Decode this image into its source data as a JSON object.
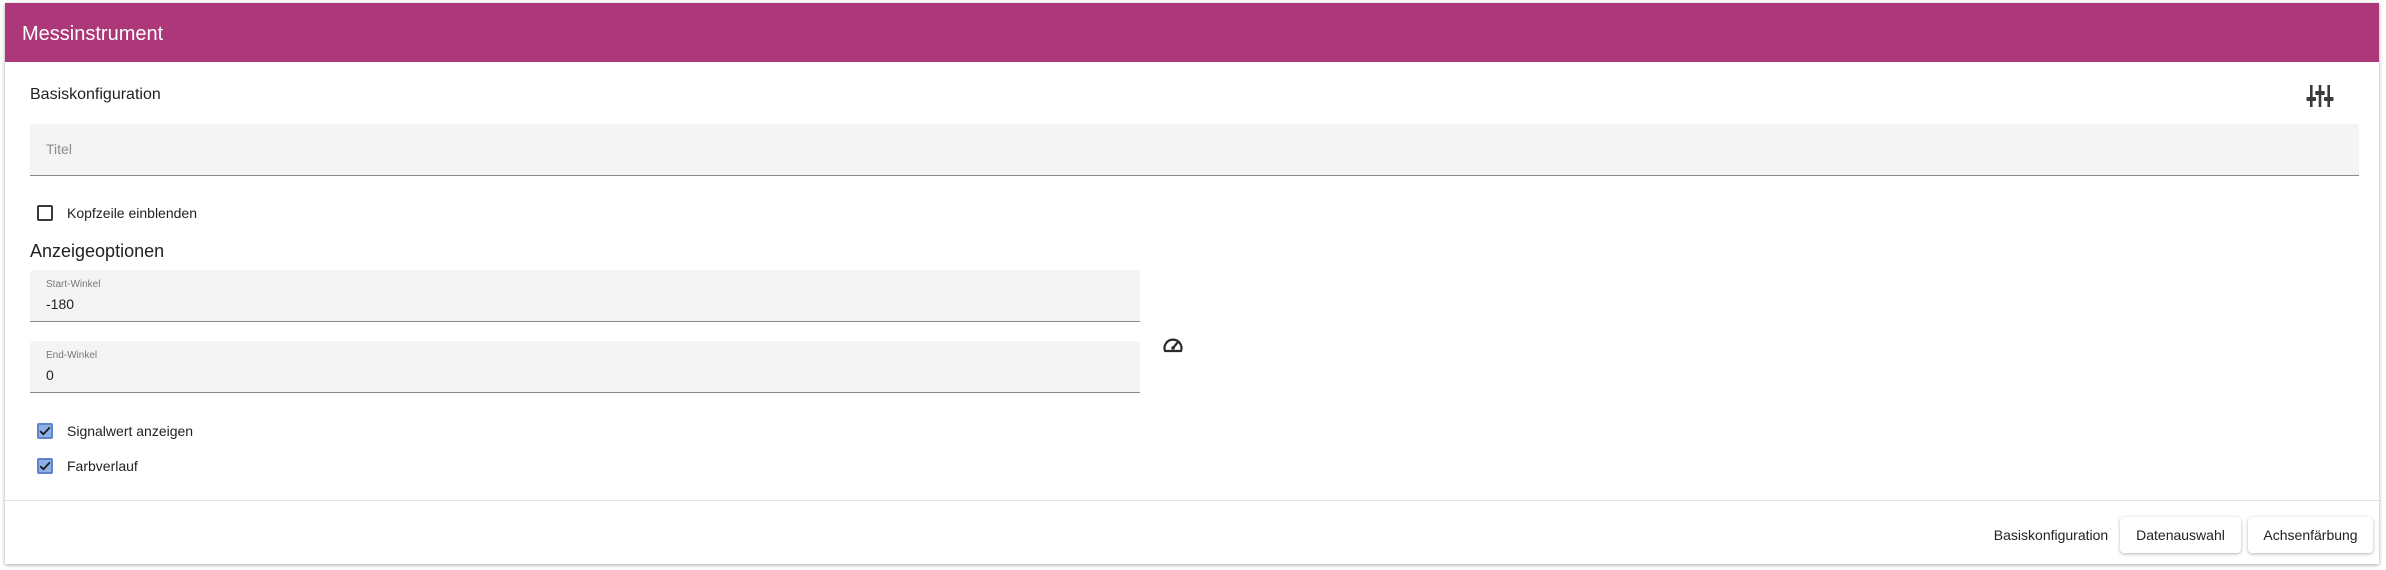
{
  "dialog": {
    "title": "Messinstrument"
  },
  "basis": {
    "section_title": "Basiskonfiguration",
    "tune_icon": "tune-sliders-icon",
    "title_field": {
      "placeholder": "Titel",
      "value": ""
    },
    "show_header": {
      "label": "Kopfzeile einblenden",
      "checked": false
    }
  },
  "display_options": {
    "heading": "Anzeigeoptionen",
    "start_angle": {
      "label": "Start-Winkel",
      "value": "-180"
    },
    "end_angle": {
      "label": "End-Winkel",
      "value": "0"
    },
    "gauge_icon": "gauge-icon",
    "show_signal_value": {
      "label": "Signalwert anzeigen",
      "checked": true
    },
    "color_gradient": {
      "label": "Farbverlauf",
      "checked": true
    }
  },
  "footer": {
    "tabs": [
      {
        "label": "Basiskonfiguration",
        "active": true
      },
      {
        "label": "Datenauswahl",
        "active": false
      },
      {
        "label": "Achsenfärbung",
        "active": false
      }
    ]
  },
  "colors": {
    "header": "#ac3779",
    "checkbox_checked": "#8fb1e8"
  }
}
